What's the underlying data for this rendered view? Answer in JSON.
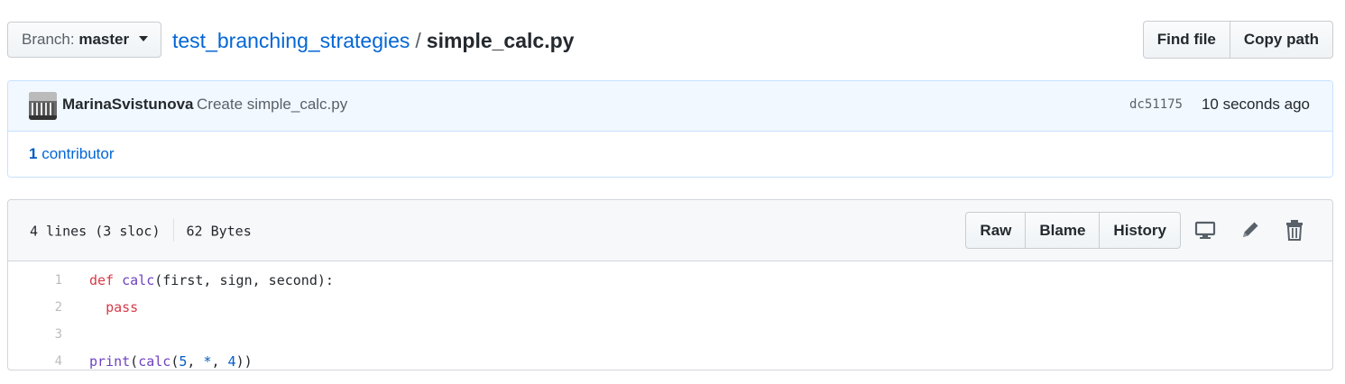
{
  "branch": {
    "prefix": "Branch:",
    "name": "master"
  },
  "breadcrumb": {
    "repo": "test_branching_strategies",
    "separator": "/",
    "file": "simple_calc.py"
  },
  "header_buttons": {
    "find_file": "Find file",
    "copy_path": "Copy path"
  },
  "commit": {
    "author": "MarinaSvistunova",
    "message": "Create simple_calc.py",
    "sha": "dc51175",
    "time": "10 seconds ago"
  },
  "contributors": {
    "count": "1",
    "label": "contributor"
  },
  "file": {
    "lines_info": "4 lines (3 sloc)",
    "size": "62 Bytes",
    "buttons": {
      "raw": "Raw",
      "blame": "Blame",
      "history": "History"
    },
    "icons": [
      "desktop-icon",
      "pencil-icon",
      "trash-icon"
    ]
  },
  "code": {
    "line_numbers": [
      "1",
      "2",
      "3",
      "4"
    ],
    "l1": {
      "kw": "def",
      "sp": " ",
      "fn": "calc",
      "rest": "(first, sign, second):"
    },
    "l2": {
      "indent": "  ",
      "kw": "pass"
    },
    "l4": {
      "fn": "print",
      "p1": "(",
      "fn2": "calc",
      "p2": "(",
      "n1": "5",
      "c1": ", ",
      "op": "*",
      "c2": ", ",
      "n2": "4",
      "p3": "))"
    }
  },
  "colors": {
    "link": "#0366d6",
    "keyword": "#d73a49",
    "function": "#6f42c1",
    "number": "#005cc5",
    "commit_bg": "#f1f8ff"
  }
}
